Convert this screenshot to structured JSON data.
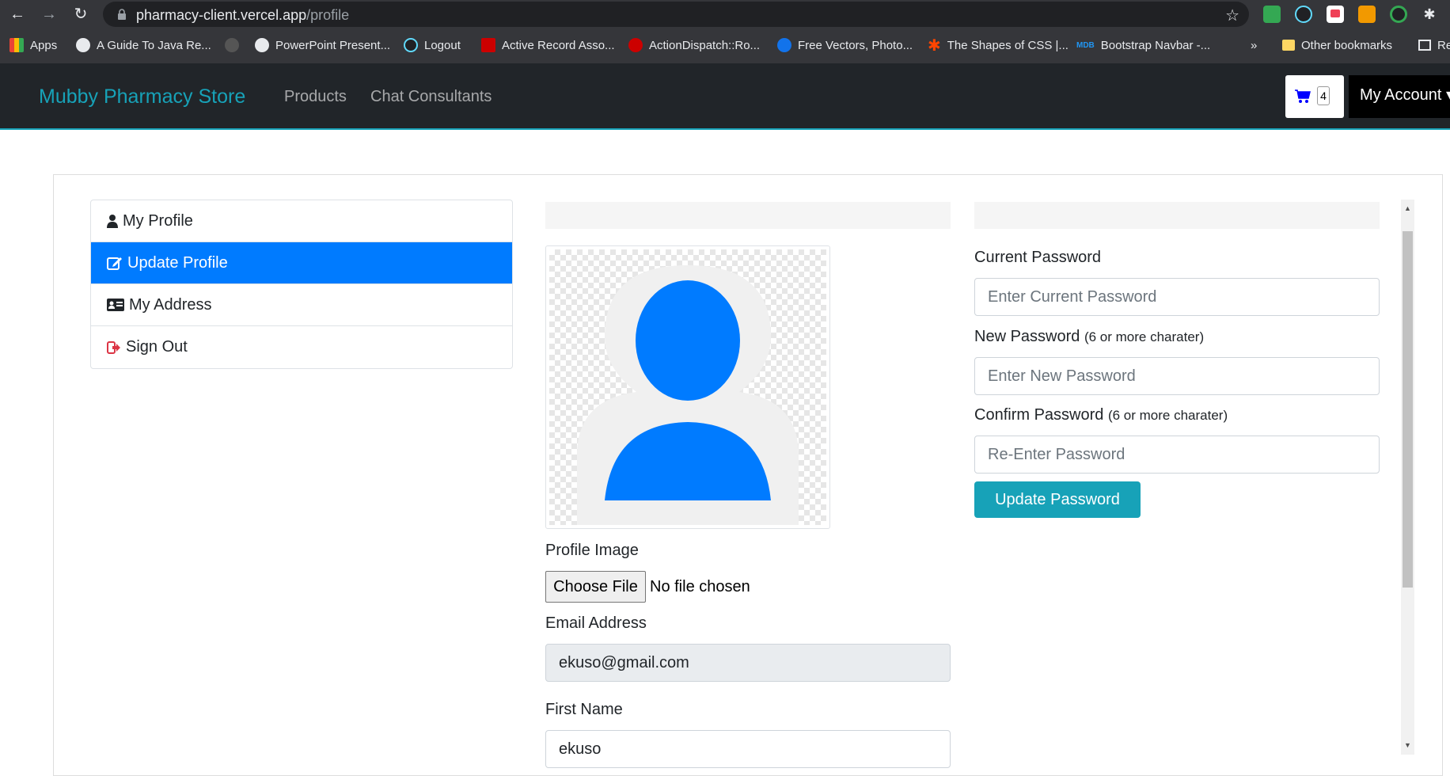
{
  "browser": {
    "url_host": "pharmacy-client.vercel.app",
    "url_path": "/profile",
    "bookmarks": [
      {
        "label": "Apps",
        "color": "#ea4335"
      },
      {
        "label": "A Guide To Java Re...",
        "color": "#e8eaed"
      },
      {
        "label": "PowerPoint Present...",
        "color": "#e8eaed"
      },
      {
        "label": "Logout",
        "color": "#61dafb"
      },
      {
        "label": "Active Record Asso...",
        "color": "#cc0000"
      },
      {
        "label": "ActionDispatch::Ro...",
        "color": "#cc0000"
      },
      {
        "label": "Free Vectors, Photo...",
        "color": "#1273eb"
      },
      {
        "label": "The Shapes of CSS |...",
        "color": "#ff4500"
      },
      {
        "label": "Bootstrap Navbar -...",
        "color": "#2196f3"
      }
    ],
    "more": "»",
    "other_bookmarks": "Other bookmarks",
    "reading_list": "Re"
  },
  "navbar": {
    "brand": "Mubby Pharmacy Store",
    "links": [
      "Products",
      "Chat Consultants"
    ],
    "cart_count": "4",
    "account": "My Account"
  },
  "sidebar": {
    "items": [
      {
        "label": "My Profile",
        "icon": "user-icon"
      },
      {
        "label": "Update Profile",
        "icon": "edit-icon"
      },
      {
        "label": "My Address",
        "icon": "address-card-icon"
      },
      {
        "label": "Sign Out",
        "icon": "sign-out-icon"
      }
    ]
  },
  "profile": {
    "image_label": "Profile Image",
    "choose_file": "Choose File",
    "file_status": "No file chosen",
    "email_label": "Email Address",
    "email_value": "ekuso@gmail.com",
    "first_name_label": "First Name",
    "first_name_value": "ekuso"
  },
  "password": {
    "current_label": "Current Password",
    "current_placeholder": "Enter Current Password",
    "new_label": "New Password",
    "new_hint": "(6 or more charater)",
    "new_placeholder": "Enter New Password",
    "confirm_label": "Confirm Password",
    "confirm_hint": "(6 or more charater)",
    "confirm_placeholder": "Re-Enter Password",
    "update_button": "Update Password"
  },
  "colors": {
    "primary": "#007bff",
    "info": "#17a2b8",
    "navbar_bg": "#212529"
  }
}
